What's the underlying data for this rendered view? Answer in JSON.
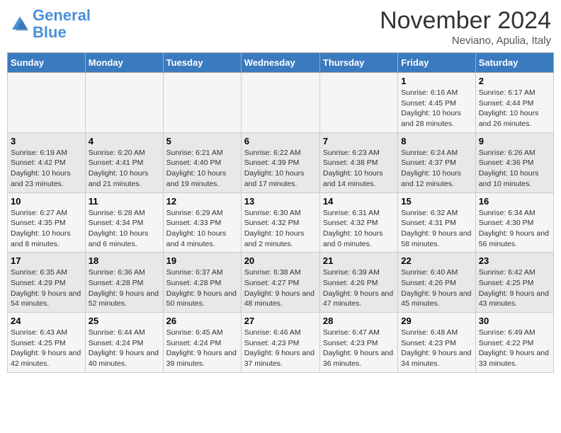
{
  "header": {
    "logo_general": "General",
    "logo_blue": "Blue",
    "month_title": "November 2024",
    "subtitle": "Neviano, Apulia, Italy"
  },
  "days_of_week": [
    "Sunday",
    "Monday",
    "Tuesday",
    "Wednesday",
    "Thursday",
    "Friday",
    "Saturday"
  ],
  "weeks": [
    [
      {
        "day": "",
        "info": ""
      },
      {
        "day": "",
        "info": ""
      },
      {
        "day": "",
        "info": ""
      },
      {
        "day": "",
        "info": ""
      },
      {
        "day": "",
        "info": ""
      },
      {
        "day": "1",
        "info": "Sunrise: 6:16 AM\nSunset: 4:45 PM\nDaylight: 10 hours and 28 minutes."
      },
      {
        "day": "2",
        "info": "Sunrise: 6:17 AM\nSunset: 4:44 PM\nDaylight: 10 hours and 26 minutes."
      }
    ],
    [
      {
        "day": "3",
        "info": "Sunrise: 6:19 AM\nSunset: 4:42 PM\nDaylight: 10 hours and 23 minutes."
      },
      {
        "day": "4",
        "info": "Sunrise: 6:20 AM\nSunset: 4:41 PM\nDaylight: 10 hours and 21 minutes."
      },
      {
        "day": "5",
        "info": "Sunrise: 6:21 AM\nSunset: 4:40 PM\nDaylight: 10 hours and 19 minutes."
      },
      {
        "day": "6",
        "info": "Sunrise: 6:22 AM\nSunset: 4:39 PM\nDaylight: 10 hours and 17 minutes."
      },
      {
        "day": "7",
        "info": "Sunrise: 6:23 AM\nSunset: 4:38 PM\nDaylight: 10 hours and 14 minutes."
      },
      {
        "day": "8",
        "info": "Sunrise: 6:24 AM\nSunset: 4:37 PM\nDaylight: 10 hours and 12 minutes."
      },
      {
        "day": "9",
        "info": "Sunrise: 6:26 AM\nSunset: 4:36 PM\nDaylight: 10 hours and 10 minutes."
      }
    ],
    [
      {
        "day": "10",
        "info": "Sunrise: 6:27 AM\nSunset: 4:35 PM\nDaylight: 10 hours and 8 minutes."
      },
      {
        "day": "11",
        "info": "Sunrise: 6:28 AM\nSunset: 4:34 PM\nDaylight: 10 hours and 6 minutes."
      },
      {
        "day": "12",
        "info": "Sunrise: 6:29 AM\nSunset: 4:33 PM\nDaylight: 10 hours and 4 minutes."
      },
      {
        "day": "13",
        "info": "Sunrise: 6:30 AM\nSunset: 4:32 PM\nDaylight: 10 hours and 2 minutes."
      },
      {
        "day": "14",
        "info": "Sunrise: 6:31 AM\nSunset: 4:32 PM\nDaylight: 10 hours and 0 minutes."
      },
      {
        "day": "15",
        "info": "Sunrise: 6:32 AM\nSunset: 4:31 PM\nDaylight: 9 hours and 58 minutes."
      },
      {
        "day": "16",
        "info": "Sunrise: 6:34 AM\nSunset: 4:30 PM\nDaylight: 9 hours and 56 minutes."
      }
    ],
    [
      {
        "day": "17",
        "info": "Sunrise: 6:35 AM\nSunset: 4:29 PM\nDaylight: 9 hours and 54 minutes."
      },
      {
        "day": "18",
        "info": "Sunrise: 6:36 AM\nSunset: 4:28 PM\nDaylight: 9 hours and 52 minutes."
      },
      {
        "day": "19",
        "info": "Sunrise: 6:37 AM\nSunset: 4:28 PM\nDaylight: 9 hours and 50 minutes."
      },
      {
        "day": "20",
        "info": "Sunrise: 6:38 AM\nSunset: 4:27 PM\nDaylight: 9 hours and 48 minutes."
      },
      {
        "day": "21",
        "info": "Sunrise: 6:39 AM\nSunset: 4:26 PM\nDaylight: 9 hours and 47 minutes."
      },
      {
        "day": "22",
        "info": "Sunrise: 6:40 AM\nSunset: 4:26 PM\nDaylight: 9 hours and 45 minutes."
      },
      {
        "day": "23",
        "info": "Sunrise: 6:42 AM\nSunset: 4:25 PM\nDaylight: 9 hours and 43 minutes."
      }
    ],
    [
      {
        "day": "24",
        "info": "Sunrise: 6:43 AM\nSunset: 4:25 PM\nDaylight: 9 hours and 42 minutes."
      },
      {
        "day": "25",
        "info": "Sunrise: 6:44 AM\nSunset: 4:24 PM\nDaylight: 9 hours and 40 minutes."
      },
      {
        "day": "26",
        "info": "Sunrise: 6:45 AM\nSunset: 4:24 PM\nDaylight: 9 hours and 39 minutes."
      },
      {
        "day": "27",
        "info": "Sunrise: 6:46 AM\nSunset: 4:23 PM\nDaylight: 9 hours and 37 minutes."
      },
      {
        "day": "28",
        "info": "Sunrise: 6:47 AM\nSunset: 4:23 PM\nDaylight: 9 hours and 36 minutes."
      },
      {
        "day": "29",
        "info": "Sunrise: 6:48 AM\nSunset: 4:23 PM\nDaylight: 9 hours and 34 minutes."
      },
      {
        "day": "30",
        "info": "Sunrise: 6:49 AM\nSunset: 4:22 PM\nDaylight: 9 hours and 33 minutes."
      }
    ]
  ]
}
